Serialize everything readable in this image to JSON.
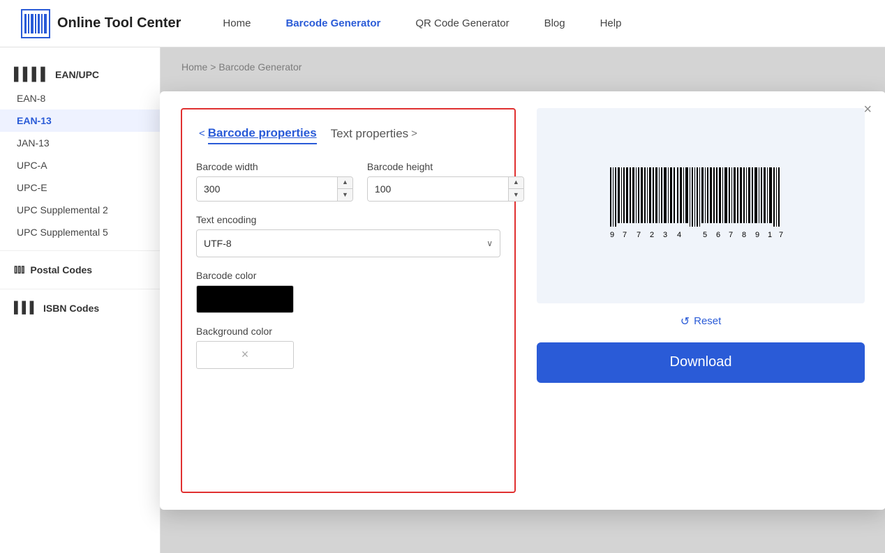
{
  "header": {
    "logo_text": "Online Tool Center",
    "nav": [
      {
        "label": "Home",
        "active": false
      },
      {
        "label": "Barcode Generator",
        "active": true
      },
      {
        "label": "QR Code Generator",
        "active": false
      },
      {
        "label": "Blog",
        "active": false
      },
      {
        "label": "Help",
        "active": false
      }
    ]
  },
  "breadcrumb": {
    "home": "Home",
    "separator": " > ",
    "current": "Barcode Generator"
  },
  "sidebar": {
    "sections": [
      {
        "label": "EAN/UPC",
        "items": [
          "EAN-8",
          "EAN-13",
          "JAN-13",
          "UPC-A",
          "UPC-E",
          "UPC Supplemental 2",
          "UPC Supplemental 5"
        ]
      },
      {
        "label": "Postal Codes",
        "items": []
      },
      {
        "label": "ISBN Codes",
        "items": []
      }
    ],
    "active_item": "EAN-13"
  },
  "modal": {
    "close_label": "×",
    "tabs": {
      "barcode_properties": "Barcode properties",
      "text_properties": "Text properties"
    },
    "fields": {
      "barcode_width_label": "Barcode width",
      "barcode_width_value": "300",
      "barcode_height_label": "Barcode height",
      "barcode_height_value": "100",
      "text_encoding_label": "Text encoding",
      "text_encoding_value": "UTF-8",
      "barcode_color_label": "Barcode color",
      "barcode_color_value": "#000000",
      "background_color_label": "Background color",
      "background_color_clear": "×"
    },
    "reset_label": "Reset",
    "download_label": "Download",
    "barcode_digits": "9 7 7 2 3 4 5 6 7 8 9 1 7"
  },
  "icons": {
    "chevron_up": "▲",
    "chevron_down": "▼",
    "chevron_left": "<",
    "chevron_right": ">",
    "reset": "↺",
    "close": "×",
    "select_arrow": "∨"
  }
}
